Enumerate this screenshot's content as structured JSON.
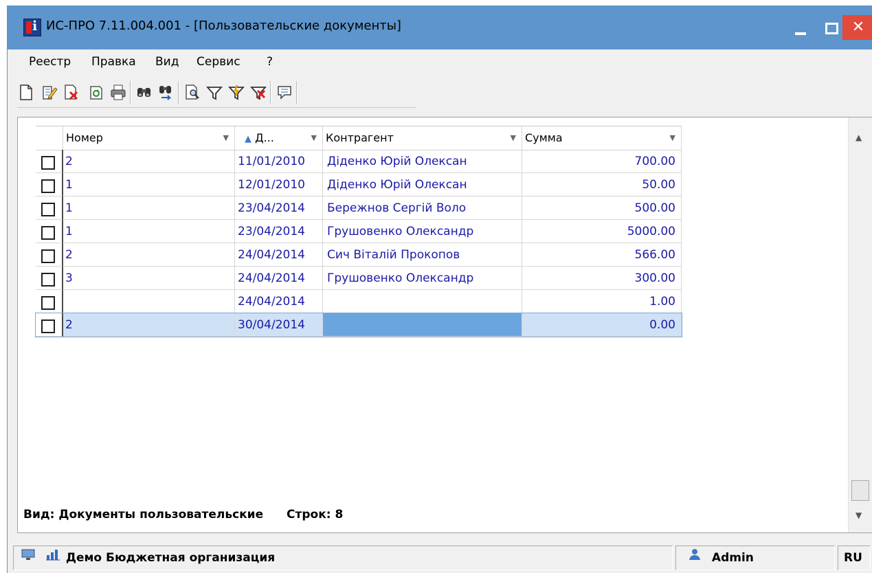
{
  "window": {
    "title": "ИС-ПРО 7.11.004.001 - [Пользовательские документы]",
    "close_glyph": "✕"
  },
  "menu": [
    "Реестр",
    "Правка",
    "Вид",
    "Сервис",
    "?"
  ],
  "toolbar": {
    "icons": [
      "new-document-icon",
      "edit-document-icon",
      "delete-document-icon",
      "refresh-icon",
      "print-icon",
      "find-icon",
      "find-next-icon",
      "preview-icon",
      "filter-icon",
      "filter-apply-icon",
      "filter-clear-icon",
      "comment-icon"
    ]
  },
  "table": {
    "columns": [
      "Номер",
      "Д...",
      "Контрагент",
      "Сумма"
    ],
    "sort_glyph": "▲",
    "rows": [
      {
        "num": "2",
        "date": "11/01/2010",
        "counterparty": "Діденко Юрій Олексан",
        "sum": "700.00"
      },
      {
        "num": "1",
        "date": "12/01/2010",
        "counterparty": "Діденко Юрій Олексан",
        "sum": "50.00"
      },
      {
        "num": "1",
        "date": "23/04/2014",
        "counterparty": "Бережнов Сергій Воло",
        "sum": "500.00"
      },
      {
        "num": "1",
        "date": "23/04/2014",
        "counterparty": "Грушовенко Олександр",
        "sum": "5000.00"
      },
      {
        "num": "2",
        "date": "24/04/2014",
        "counterparty": "Сич Віталій Прокопов",
        "sum": "566.00"
      },
      {
        "num": "3",
        "date": "24/04/2014",
        "counterparty": "Грушовенко Олександр",
        "sum": "300.00"
      },
      {
        "num": "",
        "date": "24/04/2014",
        "counterparty": "",
        "sum": "1.00"
      },
      {
        "num": "2",
        "date": "30/04/2014",
        "counterparty": "",
        "sum": "0.00"
      }
    ],
    "selected_row": 7
  },
  "status": {
    "view_text": "Вид: Документы пользовательские",
    "rows_text": "Строк: 8"
  },
  "statusbar": {
    "org": "Демо Бюджетная организация",
    "user": "Admin",
    "lang": "RU"
  },
  "colors": {
    "title_bar": "#5e95cc",
    "close_button": "#e24b3c",
    "cell_text": "#1a1aa8",
    "selection": "#cfe1f6",
    "selection_focus": "#6ba5de"
  }
}
